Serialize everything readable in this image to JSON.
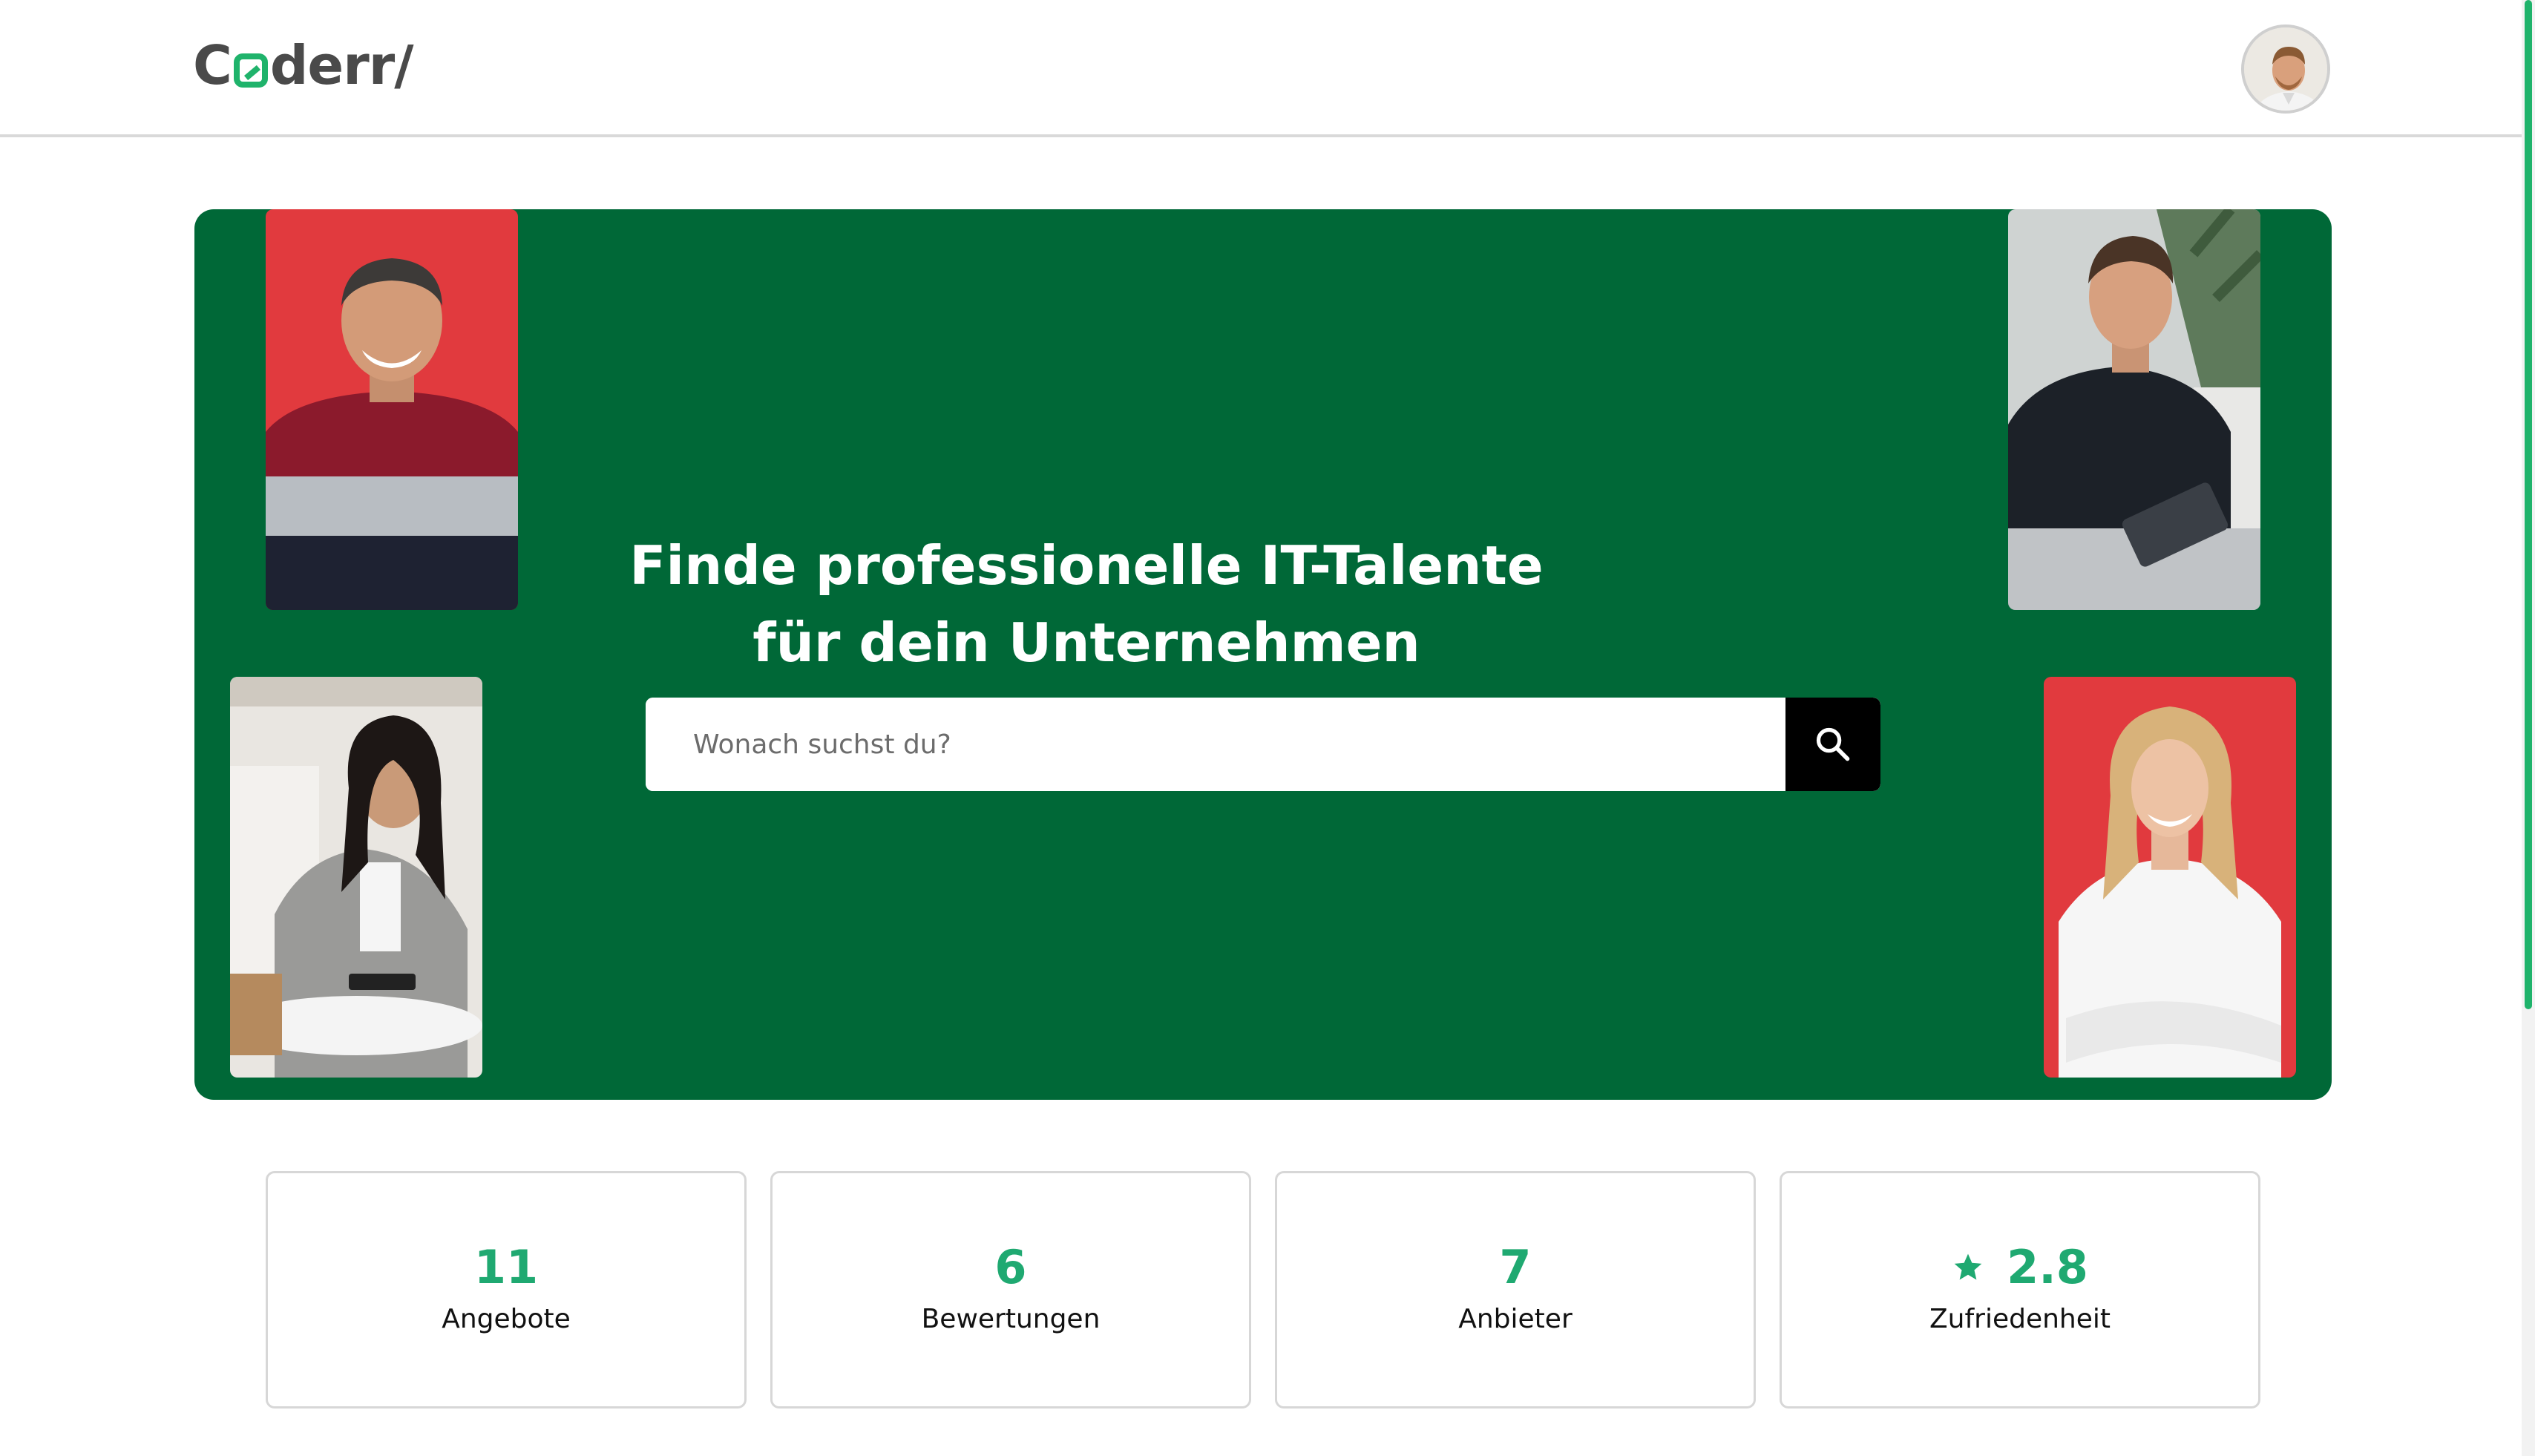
{
  "header": {
    "logo_text": "Coderr/",
    "avatar_alt": "profile-avatar"
  },
  "hero": {
    "title": "Finde professionelle IT-Talente für dein Unternehmen",
    "search": {
      "placeholder": "Wonach suchst du?",
      "value": ""
    },
    "colors": {
      "background": "#006837",
      "photo_red": "#e13a3e"
    }
  },
  "stats": [
    {
      "value": "11",
      "label": "Angebote"
    },
    {
      "value": "6",
      "label": "Bewertungen"
    },
    {
      "value": "7",
      "label": "Anbieter"
    },
    {
      "value": "2.8",
      "label": "Zufriedenheit",
      "icon": "star-icon"
    }
  ],
  "colors": {
    "accent": "#1fa971",
    "scrollbar": "#1fb36b"
  }
}
